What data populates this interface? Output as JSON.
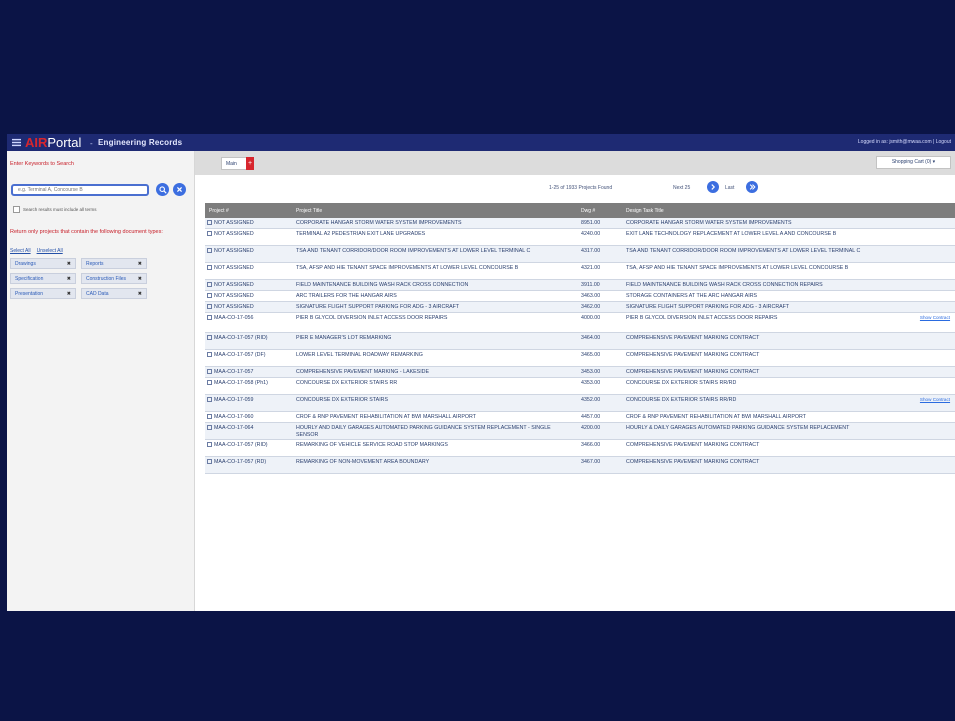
{
  "header": {
    "logo_air": "AIR",
    "logo_portal": "Portal",
    "separator": "-",
    "subtitle": "Engineering Records",
    "login_text": "Logged in as: jsmith@mwaa.com | Logout"
  },
  "sidebar": {
    "keyword_label": "Enter Keywords to Search",
    "search_placeholder": "e.g. Terminal A, Concourse B",
    "match_all_label": "Search results must include all terms",
    "return_label": "Return only projects that contain the following document types:",
    "select_all": "Select All",
    "unselect_all": "Unselect All",
    "doc_types": [
      "Drawings",
      "Reports",
      "Specification",
      "Construction Files",
      "Presentation",
      "CAD Data"
    ],
    "remove_symbol": "✖"
  },
  "main": {
    "tab_label": "Main",
    "tab_add": "+",
    "cart_label": "Shopping Cart (0) ▾",
    "results_found": "1-25 of 1933 Projects Found",
    "next_label": "Next 25",
    "last_label": "Last"
  },
  "table": {
    "headers": [
      "Project #",
      "Project Title",
      "Dwg #",
      "Design Task Title"
    ],
    "rows": [
      {
        "num": "NOT ASSIGNED",
        "title": "CORPORATE HANGAR STORM WATER SYSTEM IMPROVEMENTS",
        "no": "8951.00",
        "dtitle": "CORPORATE HANGAR STORM WATER SYSTEM IMPROVEMENTS",
        "link": ""
      },
      {
        "num": "NOT ASSIGNED",
        "title": "TERMINAL A2 PEDESTRIAN EXIT LANE UPGRADES",
        "no": "4240.00",
        "dtitle": "EXIT LANE TECHNOLOGY REPLACEMENT AT LOWER LEVEL A AND CONCOURSE B",
        "link": ""
      },
      {
        "num": "NOT ASSIGNED",
        "title": "TSA AND TENANT CORRIDOR/DOOR ROOM IMPROVEMENTS AT LOWER LEVEL TERMINAL C",
        "no": "4317.00",
        "dtitle": "TSA AND TENANT CORRIDOR/DOOR ROOM IMPROVEMENTS AT LOWER LEVEL TERMINAL C",
        "link": ""
      },
      {
        "num": "NOT ASSIGNED",
        "title": "TSA, AFSP AND HIE TENANT SPACE IMPROVEMENTS AT LOWER LEVEL CONCOURSE B",
        "no": "4321.00",
        "dtitle": "TSA, AFSP AND HIE TENANT SPACE IMPROVEMENTS AT LOWER LEVEL CONCOURSE B",
        "link": ""
      },
      {
        "num": "NOT ASSIGNED",
        "title": "FIELD MAINTENANCE BUILDING WASH RACK CROSS CONNECTION",
        "no": "3911.00",
        "dtitle": "FIELD MAINTENANCE BUILDING WASH RACK CROSS CONNECTION REPAIRS",
        "link": ""
      },
      {
        "num": "NOT ASSIGNED",
        "title": "ARC TRAILERS FOR THE HANGAR AIRS",
        "no": "3463.00",
        "dtitle": "STORAGE CONTAINERS AT THE ARC HANGAR AIRS",
        "link": ""
      },
      {
        "num": "NOT ASSIGNED",
        "title": "SIGNATURE FLIGHT SUPPORT PARKING FOR ADG - 3 AIRCRAFT",
        "no": "3462.00",
        "dtitle": "SIGNATURE FLIGHT SUPPORT PARKING FOR ADG - 3 AIRCRAFT",
        "link": ""
      },
      {
        "num": "MAA-CO-17-056",
        "title": "PIER B GLYCOL DIVERSION INLET ACCESS DOOR REPAIRS",
        "no": "4000.00",
        "dtitle": "PIER B GLYCOL DIVERSION INLET ACCESS DOOR REPAIRS",
        "link": "Show Contract"
      },
      {
        "num": "MAA-CO-17-057 (RID)",
        "title": "PIER E MANAGER'S LOT REMARKING",
        "no": "3464.00",
        "dtitle": "COMPREHENSIVE PAVEMENT MARKING CONTRACT",
        "link": ""
      },
      {
        "num": "MAA-CO-17-057 (DF)",
        "title": "LOWER LEVEL TERMINAL ROADWAY REMARKING",
        "no": "3465.00",
        "dtitle": "COMPREHENSIVE PAVEMENT MARKING CONTRACT",
        "link": ""
      },
      {
        "num": "MAA-CO-17-057",
        "title": "COMPREHENSIVE PAVEMENT MARKING - LAKESIDE",
        "no": "3453.00",
        "dtitle": "COMPREHENSIVE PAVEMENT MARKING CONTRACT",
        "link": ""
      },
      {
        "num": "MAA-CO-17-058 (Ph1)",
        "title": "CONCOURSE DX EXTERIOR STAIRS RR",
        "no": "4353.00",
        "dtitle": "CONCOURSE DX EXTERIOR STAIRS RR/RD",
        "link": ""
      },
      {
        "num": "MAA-CO-17-059",
        "title": "CONCOURSE DX EXTERIOR STAIRS",
        "no": "4352.00",
        "dtitle": "CONCOURSE DX EXTERIOR STAIRS RR/RD",
        "link": "Show Contract"
      },
      {
        "num": "MAA-CO-17-060",
        "title": "CROF & RNP PAVEMENT REHABILITATION AT BWI MARSHALL AIRPORT",
        "no": "4457.00",
        "dtitle": "CROF & RNP PAVEMENT REHABILITATION AT BWI MARSHALL AIRPORT",
        "link": ""
      },
      {
        "num": "MAA-CO-17-064",
        "title": "HOURLY AND DAILY GARAGES AUTOMATED PARKING GUIDANCE SYSTEM REPLACEMENT - SINGLE SENSOR",
        "no": "4200.00",
        "dtitle": "HOURLY & DAILY GARAGES AUTOMATED PARKING GUIDANCE SYSTEM REPLACEMENT",
        "link": ""
      },
      {
        "num": "MAA-CO-17-057 (RID)",
        "title": "REMARKING OF VEHICLE SERVICE ROAD STOP MARKINGS",
        "no": "3466.00",
        "dtitle": "COMPREHENSIVE PAVEMENT MARKING CONTRACT",
        "link": ""
      },
      {
        "num": "MAA-CO-17-057 (RD)",
        "title": "REMARKING OF NON-MOVEMENT AREA BOUNDARY",
        "no": "3467.00",
        "dtitle": "COMPREHENSIVE PAVEMENT MARKING CONTRACT",
        "link": ""
      }
    ]
  }
}
